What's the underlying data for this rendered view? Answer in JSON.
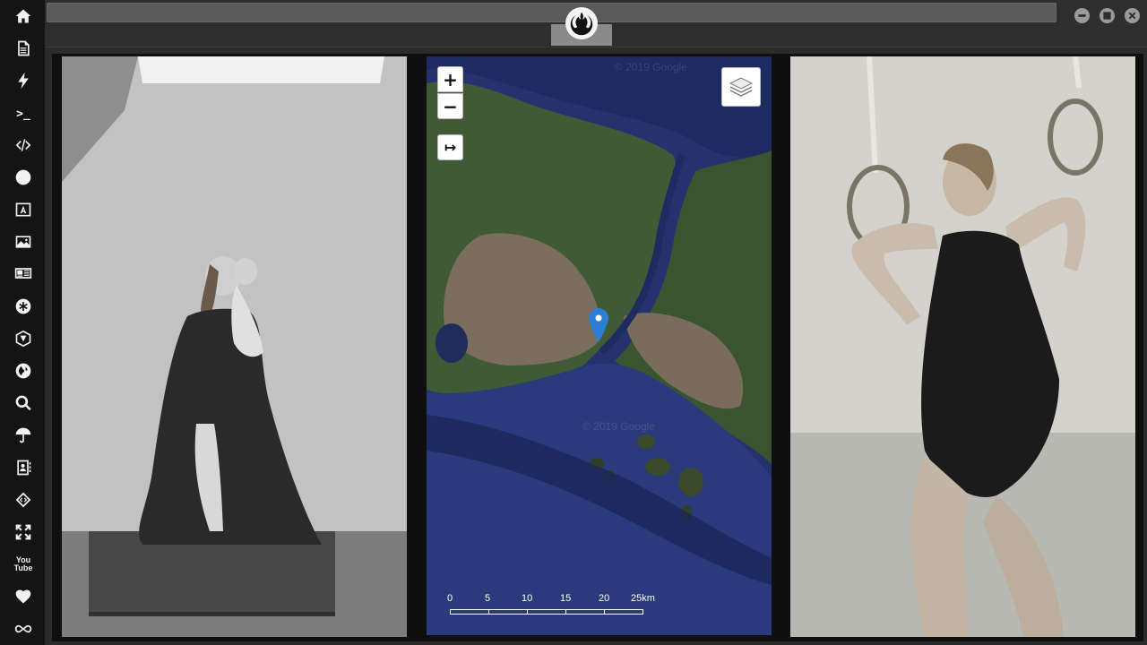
{
  "window": {
    "title_value": "",
    "buttons": [
      "minimize",
      "maximize",
      "close"
    ]
  },
  "sidebar": {
    "items": [
      {
        "name": "home-icon"
      },
      {
        "name": "document-icon"
      },
      {
        "name": "lightning-icon"
      },
      {
        "name": "terminal-icon",
        "text": ">_"
      },
      {
        "name": "code-icon"
      },
      {
        "name": "play-icon"
      },
      {
        "name": "translate-icon"
      },
      {
        "name": "image-icon"
      },
      {
        "name": "newspaper-icon"
      },
      {
        "name": "asterisk-icon"
      },
      {
        "name": "hexagon-icon"
      },
      {
        "name": "globe-icon"
      },
      {
        "name": "search-icon"
      },
      {
        "name": "umbrella-icon"
      },
      {
        "name": "contact-icon"
      },
      {
        "name": "code-fork-icon"
      },
      {
        "name": "expand-icon"
      },
      {
        "name": "youtube-icon",
        "text": "You Tube"
      },
      {
        "name": "heart-icon"
      },
      {
        "name": "infinity-icon"
      }
    ]
  },
  "map": {
    "watermark_top": "© 2019 Google",
    "watermark_mid": "© 2019 Google",
    "zoom_in": "+",
    "zoom_out": "−",
    "fullscreen": "↦",
    "scale_labels": [
      "0",
      "5",
      "10",
      "15",
      "20",
      "25km"
    ]
  },
  "colors": {
    "sidebar_bg": "#141414",
    "topbar_bg": "#2e2e2e",
    "sea": "#25306b",
    "marker": "#2d7fd3"
  }
}
